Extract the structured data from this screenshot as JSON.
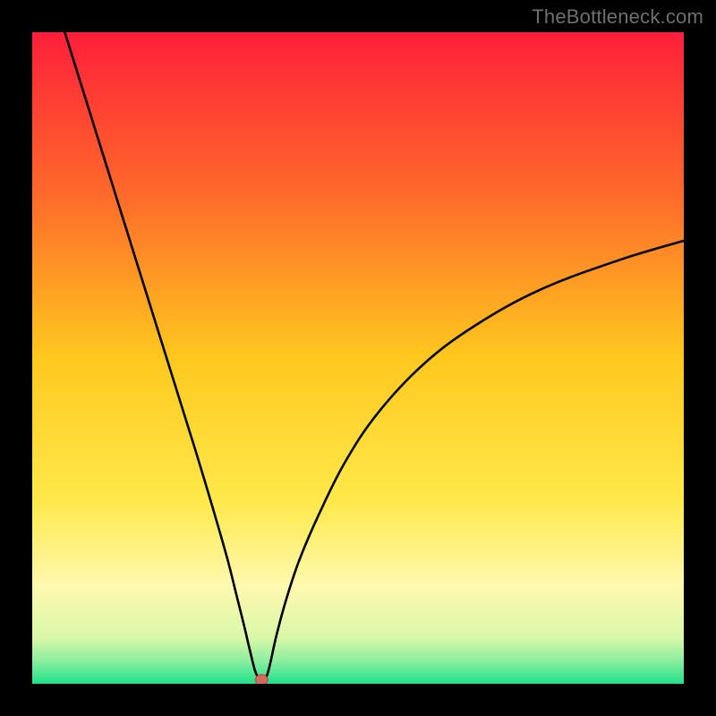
{
  "watermark": "TheBottleneck.com",
  "colors": {
    "frame": "#000000",
    "curve": "#000000",
    "marker_fill": "#d46a5f",
    "marker_stroke": "#b34d42",
    "gradient_stops": [
      {
        "offset": 0.0,
        "color": "#ff1f3a"
      },
      {
        "offset": 0.25,
        "color": "#ff6a2a"
      },
      {
        "offset": 0.5,
        "color": "#ffc81e"
      },
      {
        "offset": 0.72,
        "color": "#ffe94a"
      },
      {
        "offset": 0.85,
        "color": "#fff9b0"
      },
      {
        "offset": 0.93,
        "color": "#d9f7a8"
      },
      {
        "offset": 0.965,
        "color": "#8ceea0"
      },
      {
        "offset": 1.0,
        "color": "#1fe08a"
      }
    ]
  },
  "chart_data": {
    "type": "line",
    "title": "",
    "xlabel": "",
    "ylabel": "",
    "xlim": [
      0,
      100
    ],
    "ylim": [
      0,
      100
    ],
    "x": [
      5,
      10,
      15,
      20,
      25,
      28,
      30,
      31.5,
      32.5,
      33.2,
      33.8,
      34.2,
      34.6,
      35,
      35.4,
      35.7,
      36,
      36.5,
      37.5,
      39,
      41,
      44,
      48,
      53,
      60,
      68,
      78,
      90,
      100
    ],
    "values": [
      100,
      84,
      68,
      52,
      36,
      26,
      19,
      13,
      9,
      6,
      3.5,
      2,
      1.1,
      0.6,
      0.6,
      0.7,
      1.2,
      3,
      7.5,
      13,
      19,
      26,
      34,
      41.5,
      49,
      55,
      60.5,
      65,
      68
    ],
    "marker": {
      "x": 35.2,
      "y": 0.6
    }
  }
}
